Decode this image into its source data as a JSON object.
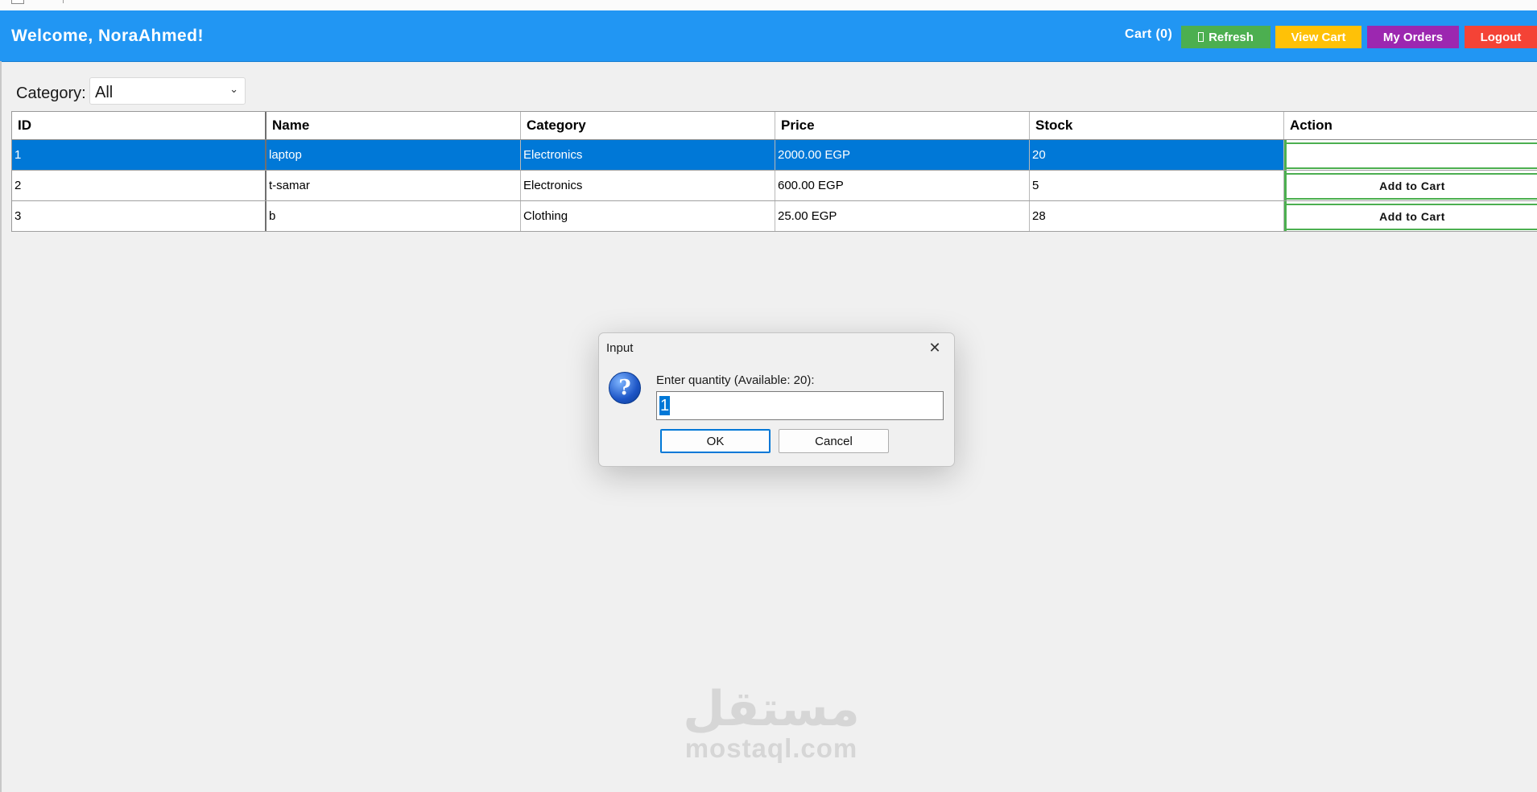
{
  "header": {
    "welcome": "Welcome, NoraAhmed!",
    "cart": "Cart (0)",
    "refresh": "Refresh",
    "view_cart": "View Cart",
    "my_orders": "My Orders",
    "logout": "Logout",
    "colors": {
      "bar": "#2196f3",
      "refresh": "#4caf50",
      "view_cart": "#ffc107",
      "my_orders": "#9c27b0",
      "logout": "#f44336"
    }
  },
  "filter": {
    "label": "Category:",
    "value": "All"
  },
  "table": {
    "columns": [
      "ID",
      "Name",
      "Category",
      "Price",
      "Stock",
      "Action"
    ],
    "rows": [
      {
        "id": "1",
        "name": "laptop",
        "category": "Electronics",
        "price": "2000.00 EGP",
        "stock": "20",
        "action": "",
        "selected": true
      },
      {
        "id": "2",
        "name": "t-samar",
        "category": "Electronics",
        "price": "600.00 EGP",
        "stock": "5",
        "action": "Add to Cart"
      },
      {
        "id": "3",
        "name": "b",
        "category": "Clothing",
        "price": "25.00 EGP",
        "stock": "28",
        "action": "Add to Cart"
      }
    ]
  },
  "dialog": {
    "title": "Input",
    "prompt": "Enter quantity (Available: 20):",
    "value": "1",
    "ok": "OK",
    "cancel": "Cancel",
    "icon": "question-icon"
  },
  "watermark": {
    "arabic": "مستقل",
    "latin": "mostaql.com"
  }
}
